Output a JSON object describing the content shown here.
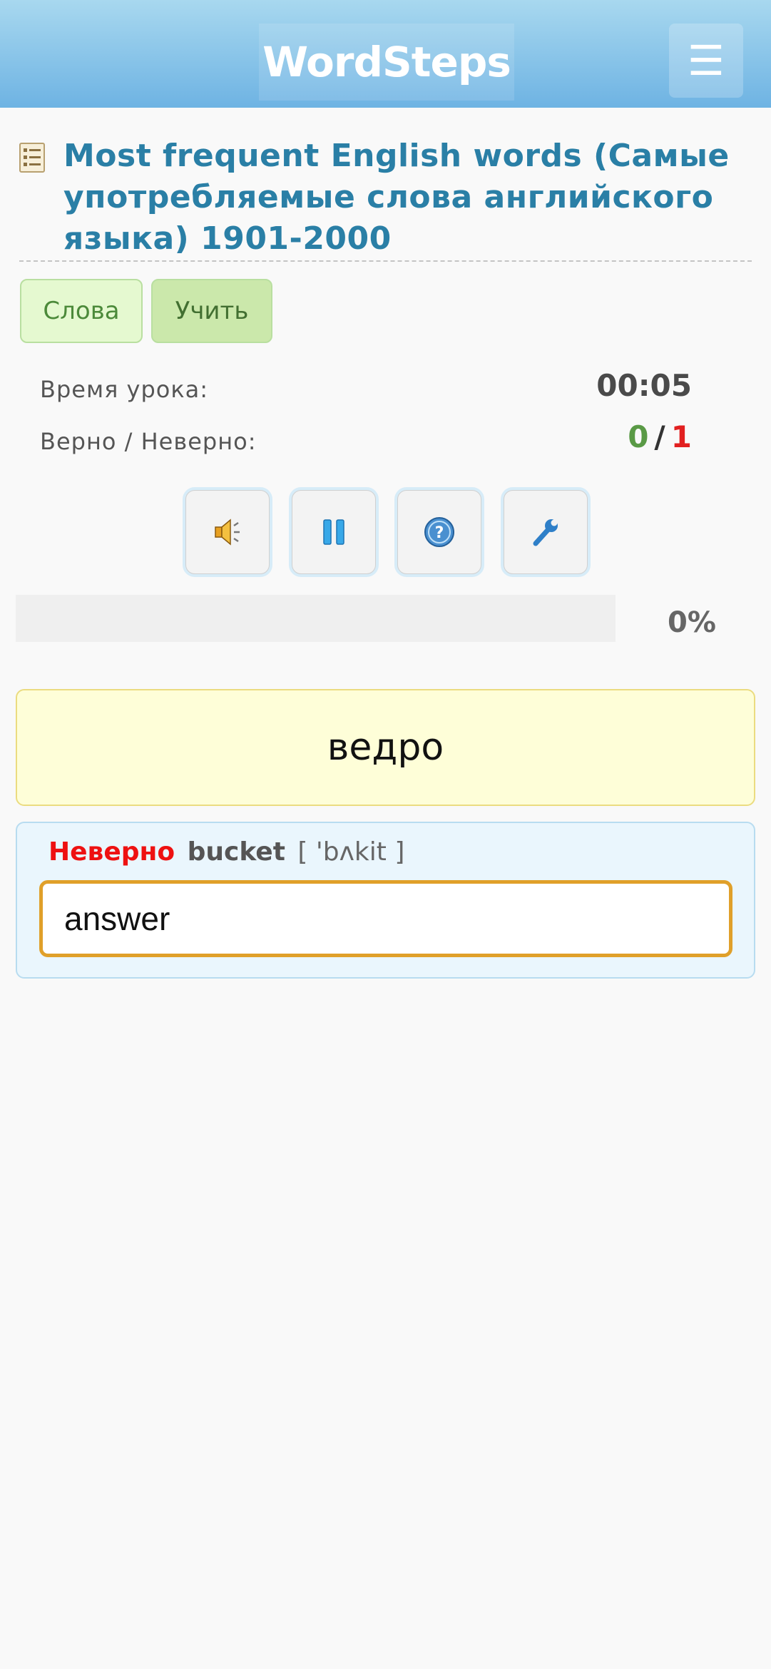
{
  "header": {
    "logo_text": "WordSteps",
    "menu_icon": "☰"
  },
  "course": {
    "title": "Most frequent English words (Самые употребляемые слова английского языка) 1901-2000"
  },
  "tabs": [
    {
      "label": "Слова"
    },
    {
      "label": "Учить"
    }
  ],
  "stats": {
    "time_label": "Время урока:",
    "time_value": "00:05",
    "score_label": "Верно / Неверно:",
    "correct": "0",
    "separator": "/",
    "wrong": "1"
  },
  "controls": [
    {
      "icon": "speaker-icon"
    },
    {
      "icon": "pause-icon"
    },
    {
      "icon": "help-icon"
    },
    {
      "icon": "wrench-icon"
    }
  ],
  "progress": {
    "percent": 0,
    "label": "0%"
  },
  "card": {
    "word": "ведро"
  },
  "answer": {
    "status": "Неверно",
    "correct_word": "bucket",
    "transcription": "[ 'bʌkit ]",
    "input_value": "answer"
  },
  "colors": {
    "header": "#6eb3e3",
    "title": "#2a7fa6",
    "correct": "#5a9a46",
    "wrong": "#e22020",
    "card_bg": "#fefed8",
    "input_border": "#e0a02a"
  }
}
